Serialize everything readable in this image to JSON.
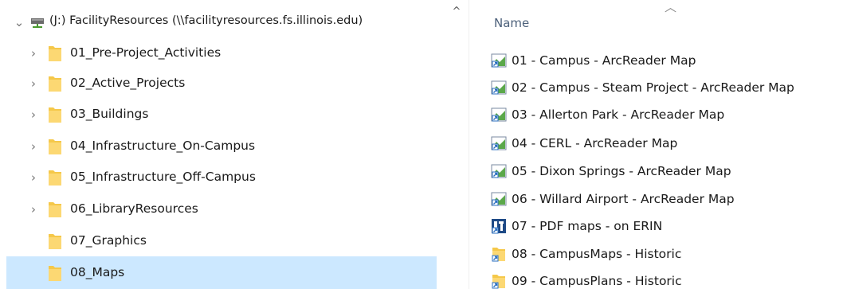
{
  "nav": {
    "drive": "(J:) FacilityResources (\\\\facilityresources.fs.illinois.edu)",
    "folders": [
      {
        "label": "01_Pre-Project_Activities",
        "expandable": true
      },
      {
        "label": "02_Active_Projects",
        "expandable": true
      },
      {
        "label": "03_Buildings",
        "expandable": true
      },
      {
        "label": "04_Infrastructure_On-Campus",
        "expandable": true
      },
      {
        "label": "05_Infrastructure_Off-Campus",
        "expandable": true
      },
      {
        "label": "06_LibraryResources",
        "expandable": true
      },
      {
        "label": "07_Graphics",
        "expandable": false
      },
      {
        "label": "08_Maps",
        "expandable": false,
        "selected": true
      }
    ]
  },
  "content": {
    "column_header": "Name",
    "files": [
      {
        "label": "01 - Campus - ArcReader Map",
        "icon": "shortcut-map-icon"
      },
      {
        "label": "02 - Campus - Steam Project - ArcReader Map",
        "icon": "shortcut-map-icon"
      },
      {
        "label": "03 - Allerton Park - ArcReader Map",
        "icon": "shortcut-map-icon"
      },
      {
        "label": "04 - CERL - ArcReader Map",
        "icon": "shortcut-map-icon"
      },
      {
        "label": "05 - Dixon Springs - ArcReader Map",
        "icon": "shortcut-map-icon"
      },
      {
        "label": "06 - Willard Airport - ArcReader Map",
        "icon": "shortcut-map-icon"
      },
      {
        "label": "07 - PDF maps - on ERIN",
        "icon": "erin-app-icon"
      },
      {
        "label": "08 - CampusMaps - Historic",
        "icon": "folder-shortcut-icon"
      },
      {
        "label": "09 - CampusPlans - Historic",
        "icon": "folder-shortcut-icon"
      }
    ]
  },
  "colors": {
    "selection": "#cce8ff",
    "folder": "#f5c84a",
    "header_text": "#4c607a"
  }
}
